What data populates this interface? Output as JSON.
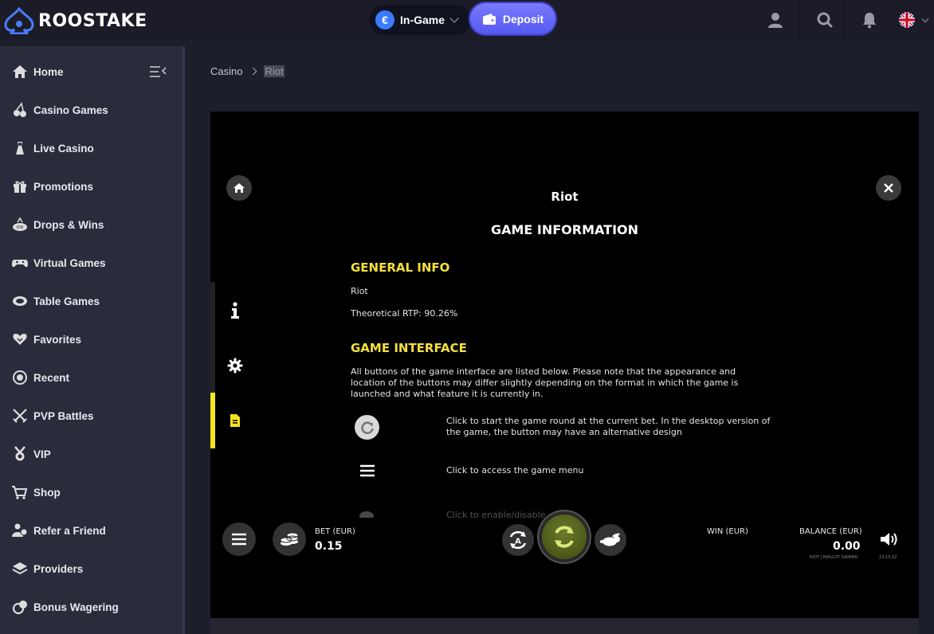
{
  "header": {
    "brand": "ROOSTAKE",
    "currency_label": "In-Game",
    "currency_symbol": "€",
    "deposit_label": "Deposit",
    "icons": [
      "user-icon",
      "search-icon",
      "bell-icon",
      "uk-flag-icon"
    ]
  },
  "sidebar": {
    "items": [
      {
        "label": "Home",
        "icon": "home-icon"
      },
      {
        "label": "Casino Games",
        "icon": "cherries-icon"
      },
      {
        "label": "Live Casino",
        "icon": "dealer-icon"
      },
      {
        "label": "Promotions",
        "icon": "gift-icon"
      },
      {
        "label": "Drops & Wins",
        "icon": "drops-wins-icon"
      },
      {
        "label": "Virtual Games",
        "icon": "gamepad-icon"
      },
      {
        "label": "Table Games",
        "icon": "table-icon"
      },
      {
        "label": "Favorites",
        "icon": "heart-icon"
      },
      {
        "label": "Recent",
        "icon": "history-icon"
      },
      {
        "label": "PVP Battles",
        "icon": "swords-icon"
      },
      {
        "label": "VIP",
        "icon": "medal-icon"
      },
      {
        "label": "Shop",
        "icon": "cart-icon"
      },
      {
        "label": "Refer a Friend",
        "icon": "refer-icon"
      },
      {
        "label": "Providers",
        "icon": "providers-icon"
      },
      {
        "label": "Bonus Wagering",
        "icon": "bonus-icon"
      }
    ]
  },
  "breadcrumb": {
    "root": "Casino",
    "current": "Riot"
  },
  "game": {
    "title": "Riot",
    "heading": "GAME INFORMATION",
    "general_info": {
      "heading": "GENERAL INFO",
      "name": "Riot",
      "rtp": "Theoretical RTP: 90.26%"
    },
    "interface": {
      "heading": "GAME INTERFACE",
      "intro": "All buttons of the game interface are listed below. Please note that the appearance and location of the buttons may differ slightly depending on the format in which the game is launched and what feature it is currently in.",
      "rows": [
        {
          "icon": "spin-icon",
          "text": "Click to start the game round at the current bet. In the desktop version of the game, the button may have an alternative design"
        },
        {
          "icon": "menu-icon",
          "text": "Click to access the game menu"
        },
        {
          "icon": "turbo-icon",
          "text": "Click to enable/disable"
        }
      ]
    },
    "bar": {
      "bet_label": "BET (EUR)",
      "bet_value": "0.15",
      "win_label": "WIN (EUR)",
      "balance_label": "BALANCE (EUR)",
      "balance_value": "0.00",
      "provider": "RIOT | MASCOT GAMING",
      "clock": "23:15:52"
    }
  }
}
